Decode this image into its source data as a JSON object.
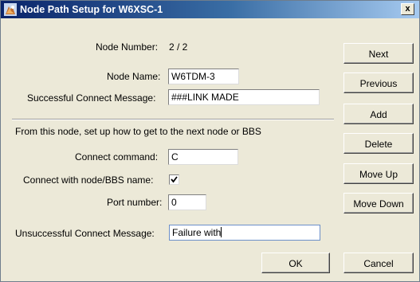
{
  "window": {
    "title": "Node Path Setup for W6XSC-1",
    "close_glyph": "x",
    "icon": "app-icon"
  },
  "form": {
    "node_number_label": "Node Number:",
    "node_number_value": "2 / 2",
    "node_name_label": "Node Name:",
    "node_name_value": "W6TDM-3",
    "success_label": "Successful Connect Message:",
    "success_value": "###LINK MADE",
    "section_text": "From this node, set up how to get to the next node or BBS",
    "connect_cmd_label": "Connect command:",
    "connect_cmd_value": "C",
    "connect_with_name_label": "Connect with node/BBS name:",
    "connect_with_name_checked": true,
    "port_label": "Port number:",
    "port_value": "0",
    "unsuccess_label": "Unsuccessful Connect Message:",
    "unsuccess_value": "Failure with"
  },
  "buttons": {
    "next": "Next",
    "previous": "Previous",
    "add": "Add",
    "delete": "Delete",
    "move_up": "Move Up",
    "move_down": "Move Down",
    "ok": "OK",
    "cancel": "Cancel"
  },
  "colors": {
    "titlebar_start": "#0a246a",
    "titlebar_end": "#a6caf0",
    "dialog_bg": "#ece9d8"
  }
}
